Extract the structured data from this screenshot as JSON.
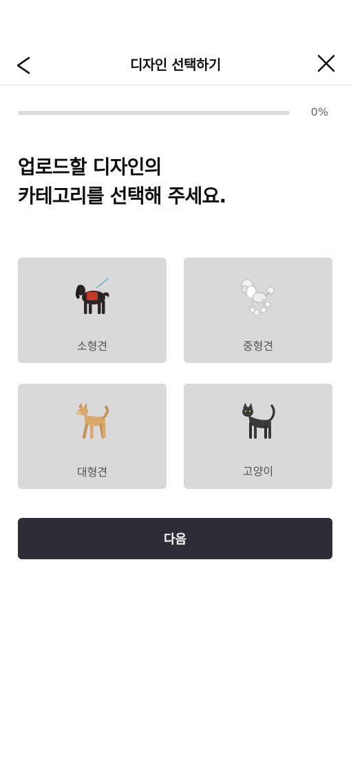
{
  "header": {
    "title": "디자인 선택하기",
    "back_icon": "chevron-left-icon",
    "close_icon": "close-icon"
  },
  "progress": {
    "value": 0,
    "label": "0%"
  },
  "question": {
    "line1": "업로드할 디자인의",
    "line2": "카테고리를 선택해 주세요."
  },
  "categories": [
    {
      "label": "소형견",
      "icon": "small-dog-icon"
    },
    {
      "label": "중형견",
      "icon": "poodle-icon"
    },
    {
      "label": "대형견",
      "icon": "large-dog-icon"
    },
    {
      "label": "고양이",
      "icon": "cat-icon"
    }
  ],
  "next_button": {
    "label": "다음"
  },
  "colors": {
    "primary": "#2d2d37",
    "card_bg": "#d9d9d9",
    "divider": "#e3e3e3"
  }
}
